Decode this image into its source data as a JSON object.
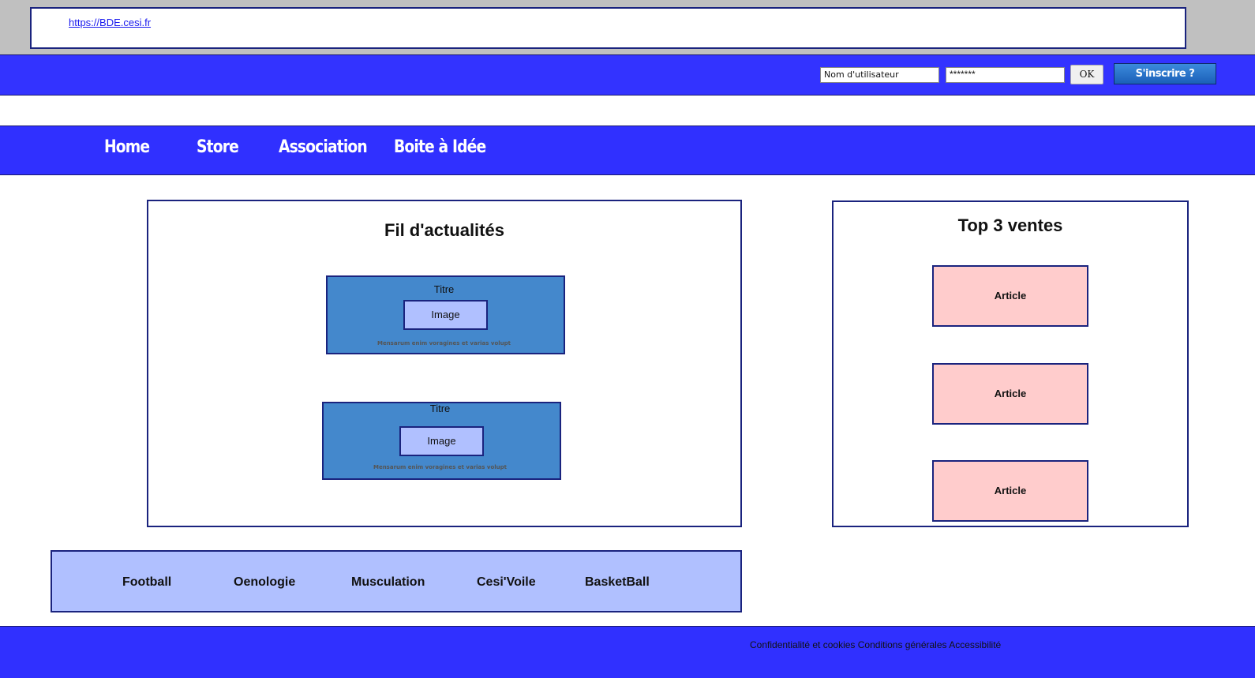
{
  "header": {
    "url_text": "https://BDE.cesi.fr"
  },
  "login": {
    "username_placeholder": "Nom d'utilisateur",
    "password_value": "*******",
    "ok_label": "OK",
    "signup_label": "S'inscrire ?"
  },
  "nav": {
    "items": [
      {
        "label": "Home"
      },
      {
        "label": "Store"
      },
      {
        "label": "Association"
      },
      {
        "label": "Boite à Idée"
      }
    ]
  },
  "news": {
    "title": "Fil d'actualités",
    "cards": [
      {
        "title": "Titre",
        "image_label": "Image",
        "text": "Mensarum enim voragines et varias volupt"
      },
      {
        "title": "Titre",
        "image_label": "Image",
        "text": "Mensarum enim voragines et varias volupt"
      }
    ]
  },
  "top_sales": {
    "title": "Top 3 ventes",
    "articles": [
      {
        "label": "Article"
      },
      {
        "label": "Article"
      },
      {
        "label": "Article"
      }
    ]
  },
  "clubs": {
    "items": [
      {
        "label": "Football"
      },
      {
        "label": "Oenologie"
      },
      {
        "label": "Musculation"
      },
      {
        "label": "Cesi'Voile"
      },
      {
        "label": "BasketBall"
      }
    ]
  },
  "footer": {
    "links": [
      {
        "label": "Confidentialité et cookies"
      },
      {
        "label": "Conditions générales"
      },
      {
        "label": "Accessibilité"
      }
    ]
  },
  "colors": {
    "primary_blue": "#3030ff",
    "card_blue": "#4488cc",
    "light_blue": "#b0c0ff",
    "article_pink": "#ffcccc",
    "border_navy": "#1a237e"
  }
}
